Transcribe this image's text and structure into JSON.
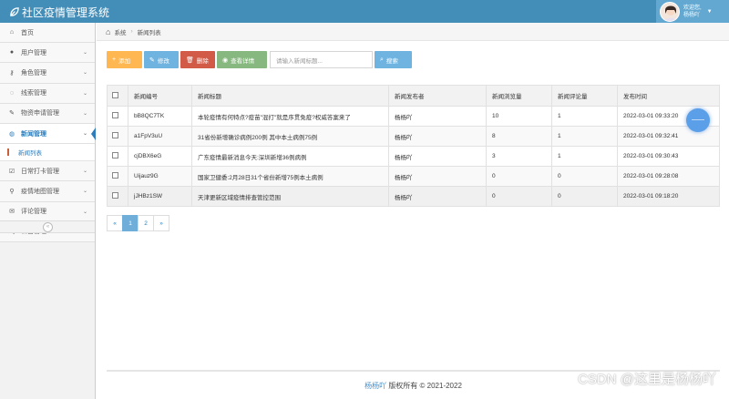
{
  "app": {
    "title": "社区疫情管理系统"
  },
  "user": {
    "greeting": "欢迎您,",
    "name": "杨杨吖"
  },
  "sidebar": {
    "items": [
      {
        "label": "首页",
        "icon": "home-icon",
        "glyph": "⌂",
        "has_chevron": false
      },
      {
        "label": "用户管理",
        "icon": "user-icon",
        "glyph": "●",
        "has_chevron": true
      },
      {
        "label": "角色管理",
        "icon": "key-icon",
        "glyph": "⚷",
        "has_chevron": true
      },
      {
        "label": "线索管理",
        "icon": "bulb-icon",
        "glyph": "◌",
        "has_chevron": true
      },
      {
        "label": "物资申请管理",
        "icon": "pencil-icon",
        "glyph": "✎",
        "has_chevron": true
      },
      {
        "label": "新闻管理",
        "icon": "globe-icon",
        "glyph": "◍",
        "has_chevron": true
      },
      {
        "label": "日常打卡管理",
        "icon": "checkbox-icon",
        "glyph": "☑",
        "has_chevron": true
      },
      {
        "label": "疫情地图管理",
        "icon": "map-marker-icon",
        "glyph": "⚲",
        "has_chevron": true
      },
      {
        "label": "评论管理",
        "icon": "comment-icon",
        "glyph": "✉",
        "has_chevron": true
      },
      {
        "label": "公告管理",
        "icon": "bullhorn-icon",
        "glyph": "◀",
        "has_chevron": true
      }
    ],
    "active_index": 5,
    "sub_item": "新闻列表"
  },
  "breadcrumb": {
    "root": "系统",
    "current": "新闻列表"
  },
  "toolbar": {
    "add": "添加",
    "edit": "修改",
    "delete": "删除",
    "view": "查看详情",
    "search_placeholder": "请输入新闻标题...",
    "search": "搜索"
  },
  "table": {
    "columns": [
      "新闻编号",
      "新闻标题",
      "新闻发布者",
      "新闻浏览量",
      "新闻评论量",
      "发布时间"
    ],
    "rows": [
      [
        "bB8QC7TK",
        "本轮疫情有何特点?疫苗\"混打\"就是序贯免疫?权威答案来了",
        "杨杨吖",
        "10",
        "1",
        "2022-03-01 09:33:20"
      ],
      [
        "a1FpV3uU",
        "31省份新增确诊病例200例 其中本土病例75例",
        "杨杨吖",
        "8",
        "1",
        "2022-03-01 09:32:41"
      ],
      [
        "cjDBX6eG",
        "广东疫情最新消息今天:深圳新增36例病例",
        "杨杨吖",
        "3",
        "1",
        "2022-03-01 09:30:43"
      ],
      [
        "Uijauz9G",
        "国家卫健委:2月28日31个省份新增75例本土病例",
        "杨杨吖",
        "0",
        "0",
        "2022-03-01 09:28:08"
      ],
      [
        "jJHBz1SW",
        "天津更新区域疫情排查管控范围",
        "杨杨吖",
        "0",
        "0",
        "2022-03-01 09:18:20"
      ]
    ]
  },
  "pagination": {
    "prev": "«",
    "pages": [
      "1",
      "2"
    ],
    "current": "1",
    "next": "»"
  },
  "footer": {
    "brand": "杨杨吖",
    "text": "版权所有 © 2021-2022"
  },
  "watermark": "CSDN @这里是杨杨吖",
  "colors": {
    "topbar": "#438eb9",
    "accent": "#2b7dbc",
    "add": "#ffb752",
    "edit": "#6fb3e0",
    "delete": "#d15b47",
    "view": "#87b87f"
  }
}
